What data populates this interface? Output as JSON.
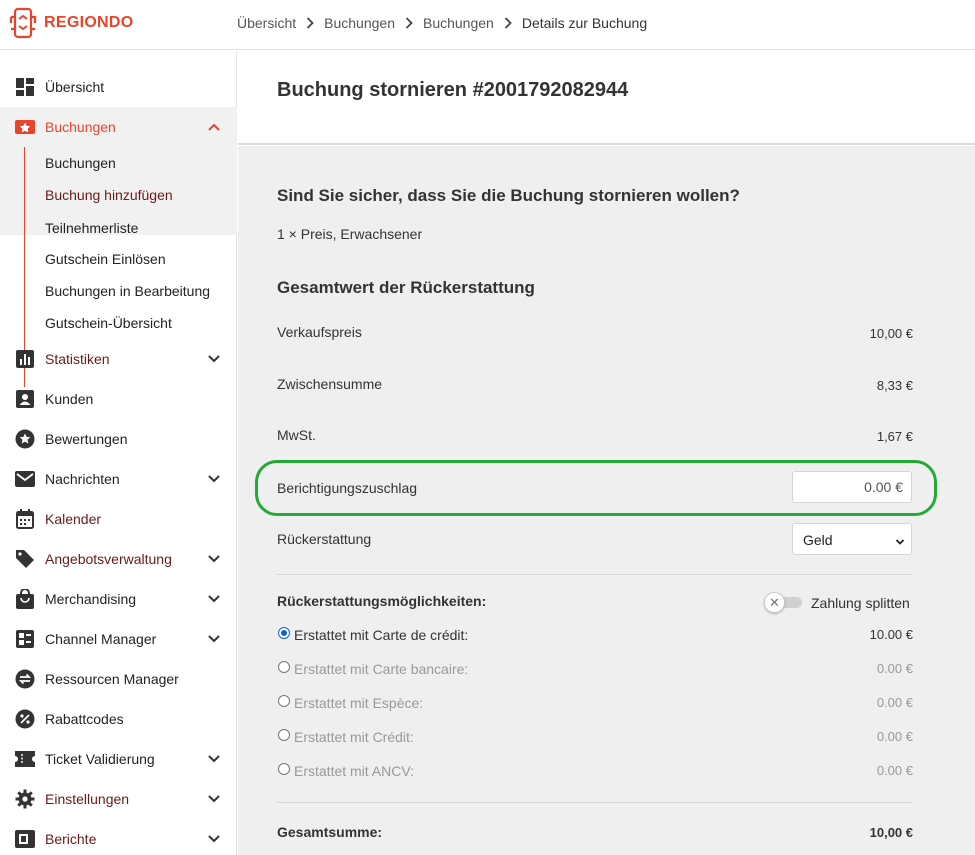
{
  "app": {
    "brand": "REGIONDO",
    "accent": "#e8442c"
  },
  "breadcrumb": [
    "Übersicht",
    "Buchungen",
    "Buchungen",
    "Details zur Buchung"
  ],
  "sidebar": {
    "items": [
      {
        "label": "Übersicht",
        "icon": "dashboard-icon"
      },
      {
        "label": "Buchungen",
        "icon": "bookings-icon",
        "expanded": true
      },
      {
        "label": "Statistiken",
        "icon": "statistics-icon"
      },
      {
        "label": "Kunden",
        "icon": "customer-icon"
      },
      {
        "label": "Bewertungen",
        "icon": "star-icon"
      },
      {
        "label": "Nachrichten",
        "icon": "mail-icon"
      },
      {
        "label": "Kalender",
        "icon": "calendar-icon"
      },
      {
        "label": "Angebotsverwaltung",
        "icon": "tag-icon"
      },
      {
        "label": "Merchandising",
        "icon": "shopping-bag-icon"
      },
      {
        "label": "Channel Manager",
        "icon": "channel-icon"
      },
      {
        "label": "Ressourcen Manager",
        "icon": "swap-icon"
      },
      {
        "label": "Rabattcodes",
        "icon": "percent-icon"
      },
      {
        "label": "Ticket Validierung",
        "icon": "ticket-icon"
      },
      {
        "label": "Einstellungen",
        "icon": "gear-icon"
      },
      {
        "label": "Berichte",
        "icon": "report-icon"
      }
    ],
    "sub_items": [
      "Buchungen",
      "Buchung hinzufügen",
      "Teilnehmerliste",
      "Gutschein Einlösen",
      "Buchungen in Bearbeitung",
      "Gutschein-Übersicht"
    ]
  },
  "page": {
    "title": "Buchung stornieren #2001792082944",
    "question": "Sind Sie sicher, dass Sie die Buchung stornieren wollen?",
    "line_item": "1 × Preis, Erwachsener",
    "refund_heading": "Gesamtwert der Rückerstattung",
    "rows": [
      {
        "label": "Verkaufspreis",
        "value": "10,00 €"
      },
      {
        "label": "Zwischensumme",
        "value": "8,33 €"
      },
      {
        "label": "MwSt.",
        "value": "1,67 €"
      }
    ],
    "adjustment": {
      "label": "Berichtigungszuschlag",
      "value": "0.00 €"
    },
    "refund_type": {
      "label": "Rückerstattung",
      "selected": "Geld"
    },
    "options_heading": "Rückerstattungsmöglichkeiten:",
    "split_label": "Zahlung splitten",
    "options": [
      {
        "label": "Erstattet mit Carte de crédit:",
        "value": "10.00 €",
        "selected": true
      },
      {
        "label": "Erstattet mit Carte bancaire:",
        "value": "0.00 €",
        "selected": false
      },
      {
        "label": "Erstattet mit Espèce:",
        "value": "0.00 €",
        "selected": false
      },
      {
        "label": "Erstattet mit Crédit:",
        "value": "0.00 €",
        "selected": false
      },
      {
        "label": "Erstattet mit ANCV:",
        "value": "0.00 €",
        "selected": false
      }
    ],
    "total": {
      "label": "Gesamtsumme:",
      "value": "10,00 €"
    }
  }
}
